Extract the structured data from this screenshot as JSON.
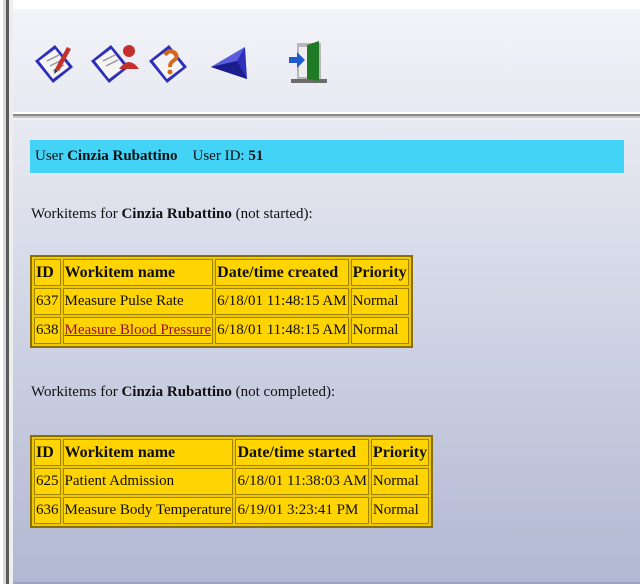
{
  "user": {
    "prefix": "User",
    "name": "Cinzia Rubattino",
    "id_label": "User ID:",
    "id": "51"
  },
  "not_started": {
    "title_prefix": "Workitems for",
    "title_name": "Cinzia Rubattino",
    "title_suffix": "(not started):",
    "headers": [
      "ID",
      "Workitem name",
      "Date/time created",
      "Priority"
    ],
    "rows": [
      {
        "id": "637",
        "name": "Measure Pulse Rate",
        "date": "6/18/01 11:48:15 AM",
        "priority": "Normal"
      },
      {
        "id": "638",
        "name": "Measure Blood Pressure",
        "date": "6/18/01 11:48:15 AM",
        "priority": "Normal"
      }
    ]
  },
  "not_completed": {
    "title_prefix": "Workitems for",
    "title_name": "Cinzia Rubattino",
    "title_suffix": "(not completed):",
    "headers": [
      "ID",
      "Workitem name",
      "Date/time started",
      "Priority"
    ],
    "rows": [
      {
        "id": "625",
        "name": "Patient Admission",
        "date": "6/18/01 11:38:03 AM",
        "priority": "Normal"
      },
      {
        "id": "636",
        "name": "Measure Body Temperature",
        "date": "6/19/01 3:23:41 PM",
        "priority": "Normal"
      }
    ]
  },
  "toolbar": {
    "icons": [
      "checklist-icon",
      "user-workitems-icon",
      "help-icon",
      "back-icon",
      "logout-icon"
    ]
  },
  "colors": {
    "userbar": "#43d3f6",
    "table": "#ffd400",
    "link": "#9b0d3b",
    "icon_accent": "#2d2fb8"
  }
}
